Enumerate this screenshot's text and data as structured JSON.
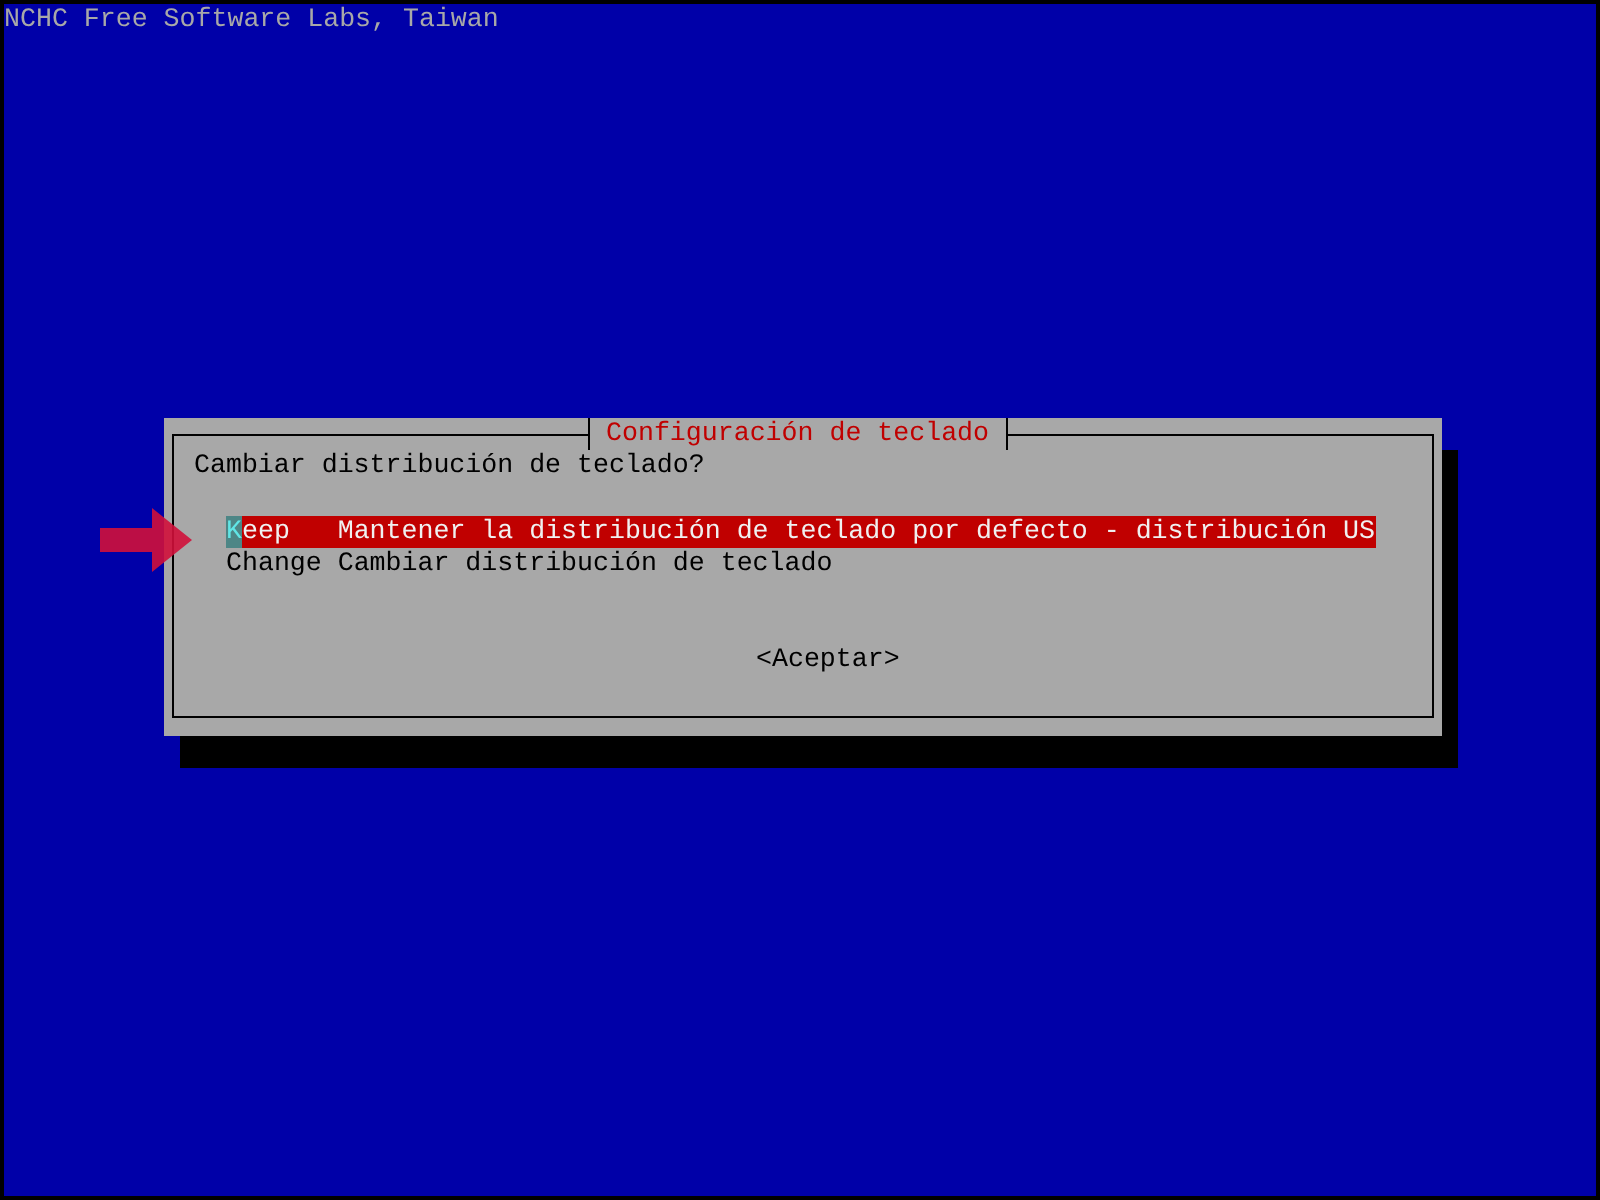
{
  "header": "NCHC Free Software Labs, Taiwan",
  "dialog": {
    "title": "Configuración de teclado",
    "question": "Cambiar distribución de teclado?",
    "options": [
      {
        "key": "Keep",
        "description": "Mantener la distribución de teclado por defecto - distribución US",
        "selected": true
      },
      {
        "key": "Change",
        "description": "Cambiar distribución de teclado",
        "selected": false
      }
    ],
    "button": "<Aceptar>"
  }
}
